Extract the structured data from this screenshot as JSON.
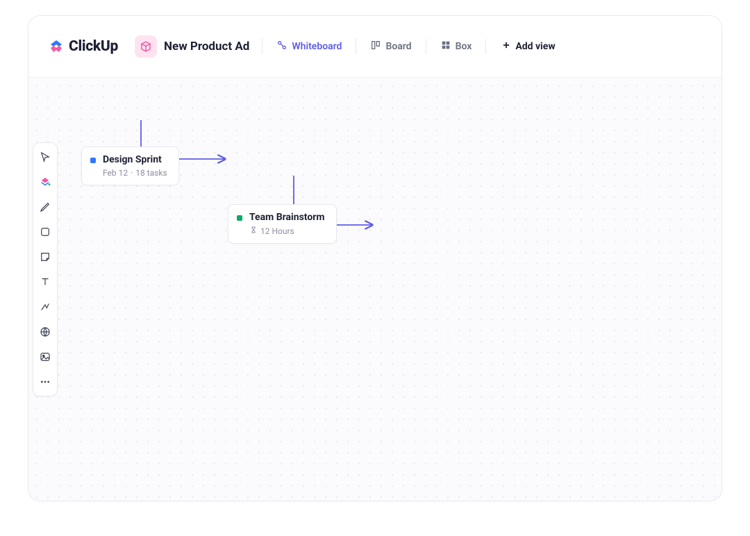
{
  "brand": {
    "name": "ClickUp"
  },
  "workspace": {
    "title": "New Product Ad"
  },
  "views": {
    "whiteboard": "Whiteboard",
    "board": "Board",
    "box": "Box",
    "add": "Add view"
  },
  "cards": {
    "design_sprint": {
      "title": "Design Sprint",
      "date": "Feb 12",
      "sep": "·",
      "tasks": "18 tasks"
    },
    "team_brainstorm": {
      "title": "Team Brainstorm",
      "hours": "12 Hours"
    }
  },
  "toolbar_icons": [
    "pointer-icon",
    "clickup-plus-icon",
    "pencil-icon",
    "shape-icon",
    "sticky-note-icon",
    "text-icon",
    "connector-icon",
    "web-icon",
    "image-icon",
    "more-icon"
  ],
  "colors": {
    "accent": "#5E5CE6",
    "card1": "#3176FF",
    "card2": "#0FA968",
    "ws_bg": "#FFE3F1",
    "ws_fg": "#F557A5"
  }
}
